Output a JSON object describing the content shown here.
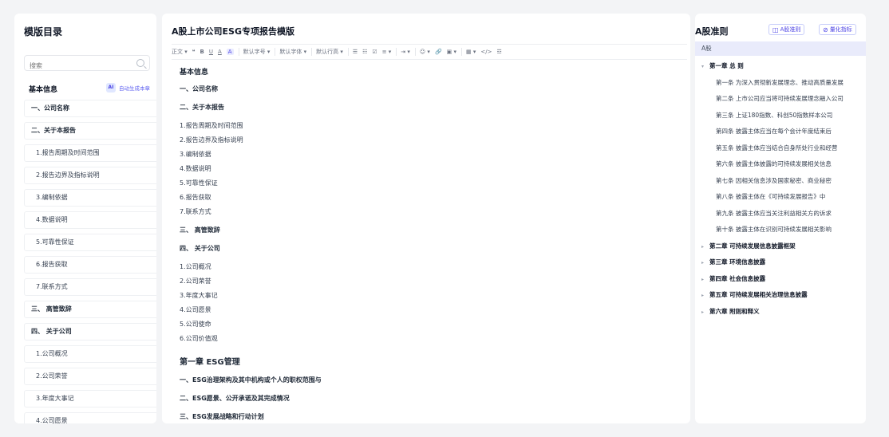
{
  "left": {
    "title": "模版目录",
    "search_placeholder": "搜索",
    "basic_info_label": "基本信息",
    "auto_icon": "AI",
    "auto_label": "自动生成本章",
    "items": [
      {
        "label": "一、公司名称",
        "level": 1
      },
      {
        "label": "二、关于本报告",
        "level": 1
      },
      {
        "label": "1.报告周期及时间范围",
        "level": 2
      },
      {
        "label": "2.报告边界及指标说明",
        "level": 2
      },
      {
        "label": "3.编制依据",
        "level": 2
      },
      {
        "label": "4.数据说明",
        "level": 2
      },
      {
        "label": "5.可靠性保证",
        "level": 2
      },
      {
        "label": "6.报告获取",
        "level": 2
      },
      {
        "label": "7.联系方式",
        "level": 2
      },
      {
        "label": "三、 高管致辞",
        "level": 1
      },
      {
        "label": "四、 关于公司",
        "level": 1
      },
      {
        "label": "1.公司概况",
        "level": 2
      },
      {
        "label": "2.公司荣誉",
        "level": 2
      },
      {
        "label": "3.年度大事记",
        "level": 2
      },
      {
        "label": "4.公司愿景",
        "level": 2
      }
    ]
  },
  "mid": {
    "doc_title": "A股上市公司ESG专项报告模版",
    "toolbar": {
      "para_style": "正文 ▾",
      "quote": "❝",
      "bold": "B",
      "underline": "U",
      "font_color": "A",
      "highlight": "A",
      "font_size": "默认字号 ▾",
      "font_family": "默认字体 ▾",
      "line_height": "默认行高 ▾",
      "bullet_list": "☰",
      "number_list": "☷",
      "todo": "☑",
      "align": "≡ ▾",
      "indent": "⇥ ▾",
      "emoji": "☺ ▾",
      "link": "🔗",
      "image": "▣ ▾",
      "table": "▦ ▾",
      "code": "</>",
      "divider": "☲"
    },
    "lines": [
      {
        "text": "基本信息",
        "type": "h"
      },
      {
        "text": "一、公司名称",
        "type": "sh"
      },
      {
        "text": "二、关于本报告",
        "type": "sh"
      },
      {
        "text": "1.报告周期及时间范围",
        "type": "p"
      },
      {
        "text": "2.报告边界及指标说明",
        "type": "p"
      },
      {
        "text": "3.编制依据",
        "type": "p"
      },
      {
        "text": "4.数据说明",
        "type": "p"
      },
      {
        "text": "5.可靠性保证",
        "type": "p"
      },
      {
        "text": "6.报告获取",
        "type": "p"
      },
      {
        "text": "7.联系方式",
        "type": "p"
      },
      {
        "text": "三、 高管致辞",
        "type": "sh"
      },
      {
        "text": "四、 关于公司",
        "type": "sh"
      },
      {
        "text": "1.公司概况",
        "type": "p"
      },
      {
        "text": "2.公司荣誉",
        "type": "p"
      },
      {
        "text": "3.年度大事记",
        "type": "p"
      },
      {
        "text": "4.公司愿景",
        "type": "p"
      },
      {
        "text": "5.公司使命",
        "type": "p"
      },
      {
        "text": "6.公司价值观",
        "type": "p"
      },
      {
        "text": "第一章 ESG管理",
        "type": "ch"
      },
      {
        "text": "一、ESG治理架构及其中机构或个人的职权范围与",
        "type": "sh"
      },
      {
        "text": "二、ESG愿景、公开承诺及其完成情况",
        "type": "sh"
      },
      {
        "text": "三、ESG发展战略和行动计划",
        "type": "sh"
      }
    ]
  },
  "right": {
    "title": "A股准则",
    "btn_rules": "A股准则",
    "btn_rules_icon": "◫",
    "btn_metrics": "量化指标",
    "btn_metrics_icon": "⊘",
    "tab": "A股",
    "tree": [
      {
        "text": "第一章 总 则",
        "type": "ch",
        "arrow": "▾"
      },
      {
        "text": "第一条 为深入贯彻新发展理念、推动高质量发展",
        "type": "art"
      },
      {
        "text": "第二条 上市公司应当将可持续发展理念融入公司",
        "type": "art"
      },
      {
        "text": "第三条 上证180指数、科创50指数样本公司",
        "type": "art"
      },
      {
        "text": "第四条 披露主体应当在每个会计年度结束后",
        "type": "art"
      },
      {
        "text": "第五条 披露主体应当结合自身所处行业和经营",
        "type": "art"
      },
      {
        "text": "第六条 披露主体披露的可持续发展相关信息",
        "type": "art"
      },
      {
        "text": "第七条 因相关信息涉及国家秘密、商业秘密",
        "type": "art"
      },
      {
        "text": "第八条 披露主体在《可持续发展报告》中",
        "type": "art"
      },
      {
        "text": "第九条 披露主体应当关注利益相关方的诉求",
        "type": "art"
      },
      {
        "text": "第十条 披露主体在识别可持续发展相关影响",
        "type": "art"
      },
      {
        "text": "第二章 可持续发展信息披露框架",
        "type": "ch",
        "arrow": "▸"
      },
      {
        "text": "第三章 环境信息披露",
        "type": "ch",
        "arrow": "▸"
      },
      {
        "text": "第四章 社会信息披露",
        "type": "ch",
        "arrow": "▸"
      },
      {
        "text": "第五章 可持续发展相关治理信息披露",
        "type": "ch",
        "arrow": "▸"
      },
      {
        "text": "第六章 附则和释义",
        "type": "ch",
        "arrow": "▸"
      }
    ]
  },
  "colors": {
    "accent": "#4f46e5",
    "accent_light": "#e9ebfb",
    "background": "#f3f4f6"
  }
}
